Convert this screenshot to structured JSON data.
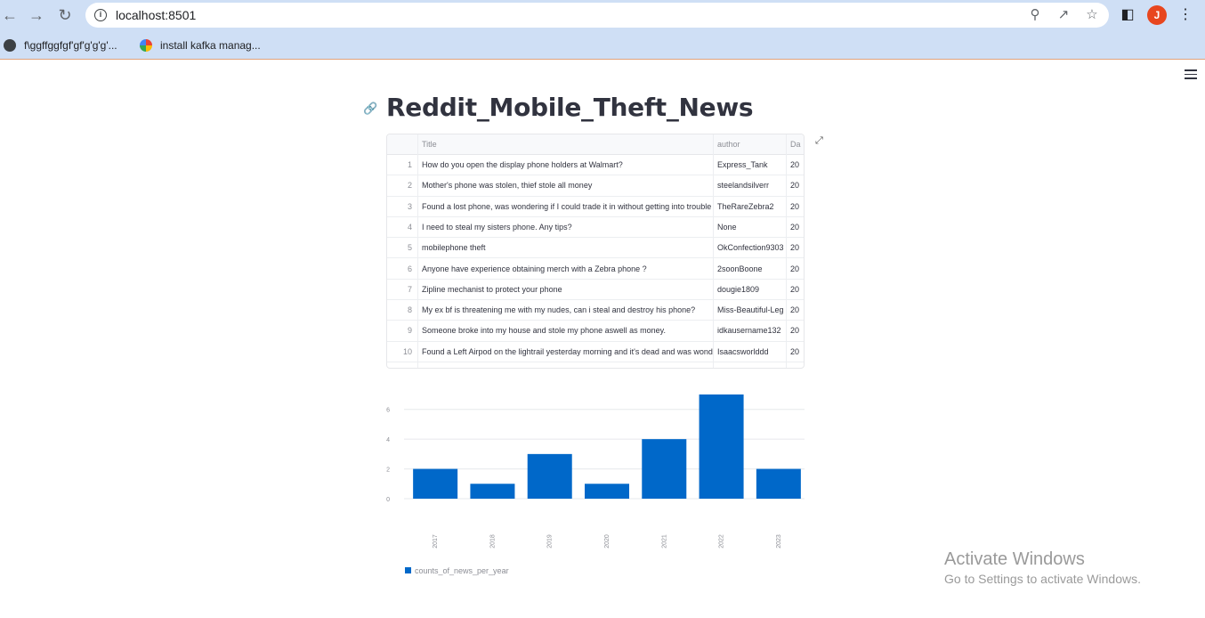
{
  "browser": {
    "url": "localhost:8501",
    "avatar_letter": "J",
    "bookmarks": [
      {
        "label": "f\\ggffggfgf'gf'g'g'g'..."
      },
      {
        "label": "install kafka manag..."
      }
    ]
  },
  "page": {
    "title": "Reddit_Mobile_Theft_News"
  },
  "dataframe": {
    "columns": [
      "Title",
      "author",
      "Da"
    ],
    "rows": [
      {
        "index": "1",
        "title": "How do you open the display phone holders at Walmart?",
        "author": "Express_Tank",
        "date": "20"
      },
      {
        "index": "2",
        "title": "Mother's phone was stolen, thief stole all money",
        "author": "steelandsilverr",
        "date": "20"
      },
      {
        "index": "3",
        "title": "Found a lost phone, was wondering if I could trade it in without getting into trouble",
        "author": "TheRareZebra2",
        "date": "20"
      },
      {
        "index": "4",
        "title": "I need to steal my sisters phone. Any tips?",
        "author": "None",
        "date": "20"
      },
      {
        "index": "5",
        "title": "mobilephone theft",
        "author": "OkConfection9303",
        "date": "20"
      },
      {
        "index": "6",
        "title": "Anyone have experience obtaining merch with a Zebra phone ?",
        "author": "2soonBoone",
        "date": "20"
      },
      {
        "index": "7",
        "title": "Zipline mechanist to protect your phone",
        "author": "dougie1809",
        "date": "20"
      },
      {
        "index": "8",
        "title": "My ex bf is threatening me with my nudes, can i steal and destroy his phone?",
        "author": "Miss-Beautiful-Leg",
        "date": "20"
      },
      {
        "index": "9",
        "title": "Someone broke into my house and stole my phone aswell as money.",
        "author": "idkausername132",
        "date": "20"
      },
      {
        "index": "10",
        "title": "Found a Left Airpod on the lightrail yesterday morning and it's dead and was wondering",
        "author": "Isaacsworlddd",
        "date": "20"
      }
    ]
  },
  "chart_data": {
    "type": "bar",
    "categories": [
      "2017",
      "2018",
      "2019",
      "2020",
      "2021",
      "2022",
      "2023"
    ],
    "series": [
      {
        "name": "counts_of_news_per_year",
        "values": [
          2,
          1,
          3,
          1,
          4,
          7,
          2
        ]
      }
    ],
    "yticks": [
      "0",
      "2",
      "4",
      "6"
    ],
    "ylim": [
      0,
      7
    ],
    "color": "#0068c9",
    "grid": true,
    "legend": "bottom-left",
    "title": "",
    "xlabel": "",
    "ylabel": ""
  },
  "watermark": {
    "line1": "Activate Windows",
    "line2": "Go to Settings to activate Windows."
  }
}
